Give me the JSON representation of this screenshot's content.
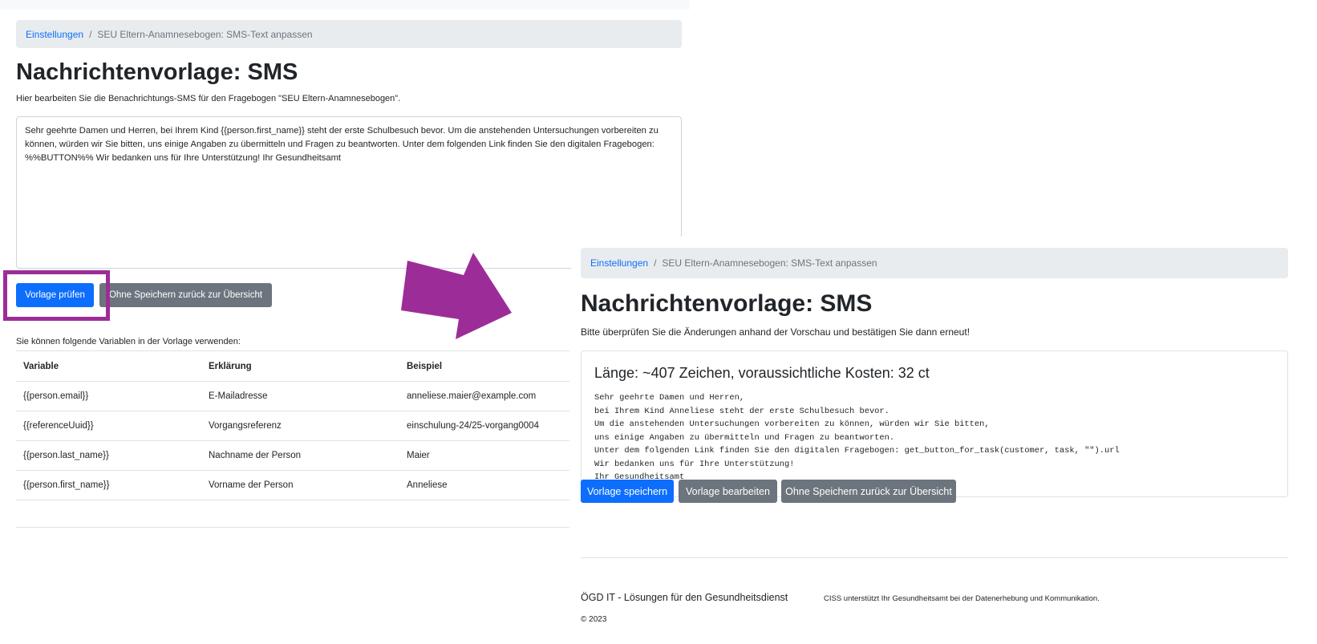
{
  "left": {
    "breadcrumb": {
      "link": "Einstellungen",
      "separator": "/",
      "current": "SEU Eltern-Anamnesebogen: SMS-Text anpassen"
    },
    "title": "Nachrichtenvorlage: SMS",
    "subtitle": "Hier bearbeiten Sie die Benachrichtungs-SMS für den Fragebogen \"SEU Eltern-Anamnesebogen\".",
    "template_text": "Sehr geehrte Damen und Herren, bei Ihrem Kind {{person.first_name}} steht der erste Schulbesuch bevor. Um die anstehenden Untersuchungen vorbereiten zu können, würden wir Sie bitten, uns einige Angaben zu übermitteln und Fragen zu beantworten. Unter dem folgenden Link finden Sie den digitalen Fragebogen: %%BUTTON%% Wir bedanken uns für Ihre Unterstützung! Ihr Gesundheitsamt",
    "buttons": {
      "check": "Vorlage prüfen",
      "back": "Ohne Speichern zurück zur Übersicht"
    },
    "variables_caption": "Sie können folgende Variablen in der Vorlage verwenden:",
    "table": {
      "headers": {
        "variable": "Variable",
        "explanation": "Erklärung",
        "example": "Beispiel"
      },
      "rows": [
        {
          "variable": "{{person.email}}",
          "explanation": "E-Mailadresse",
          "example": "anneliese.maier@example.com"
        },
        {
          "variable": "{{referenceUuid}}",
          "explanation": "Vorgangsreferenz",
          "example": "einschulung-24/25-vorgang0004"
        },
        {
          "variable": "{{person.last_name}}",
          "explanation": "Nachname der Person",
          "example": "Maier"
        },
        {
          "variable": "{{person.first_name}}",
          "explanation": "Vorname der Person",
          "example": "Anneliese"
        }
      ]
    }
  },
  "annotation": {
    "highlight_color": "#9c2d98",
    "arrow_color": "#9c2d98",
    "arrow": "right-arrow-icon"
  },
  "right": {
    "breadcrumb": {
      "link": "Einstellungen",
      "separator": "/",
      "current": "SEU Eltern-Anamnesebogen: SMS-Text anpassen"
    },
    "title": "Nachrichtenvorlage: SMS",
    "subtitle": "Bitte überprüfen Sie die Änderungen anhand der Vorschau und bestätigen Sie dann erneut!",
    "preview": {
      "heading": "Länge: ~407 Zeichen, voraussichtliche Kosten: 32 ct",
      "lines": [
        "Sehr geehrte Damen und Herren,",
        "bei Ihrem Kind Anneliese steht der erste Schulbesuch bevor.",
        "Um die anstehenden Untersuchungen vorbereiten zu können, würden wir Sie bitten,",
        "uns einige Angaben zu übermitteln und Fragen zu beantworten.",
        "Unter dem folgenden Link finden Sie den digitalen Fragebogen: get_button_for_task(customer, task, \"\").url",
        "Wir bedanken uns für Ihre Unterstützung!",
        "Ihr Gesundheitsamt"
      ]
    },
    "buttons": {
      "save": "Vorlage speichern",
      "edit": "Vorlage bearbeiten",
      "back": "Ohne Speichern zurück zur Übersicht"
    },
    "footer": {
      "brand": "ÖGD IT - Lösungen für den Gesundheitsdienst",
      "tagline": "CISS unterstützt Ihr Gesundheitsamt bei der Datenerhebung und Kommunikation.",
      "copyright": "© 2023"
    }
  },
  "colors": {
    "primary": "#0d6efd",
    "secondary": "#6c757d",
    "breadcrumb_bg": "#e9ecef",
    "annotation": "#9c2d98"
  }
}
